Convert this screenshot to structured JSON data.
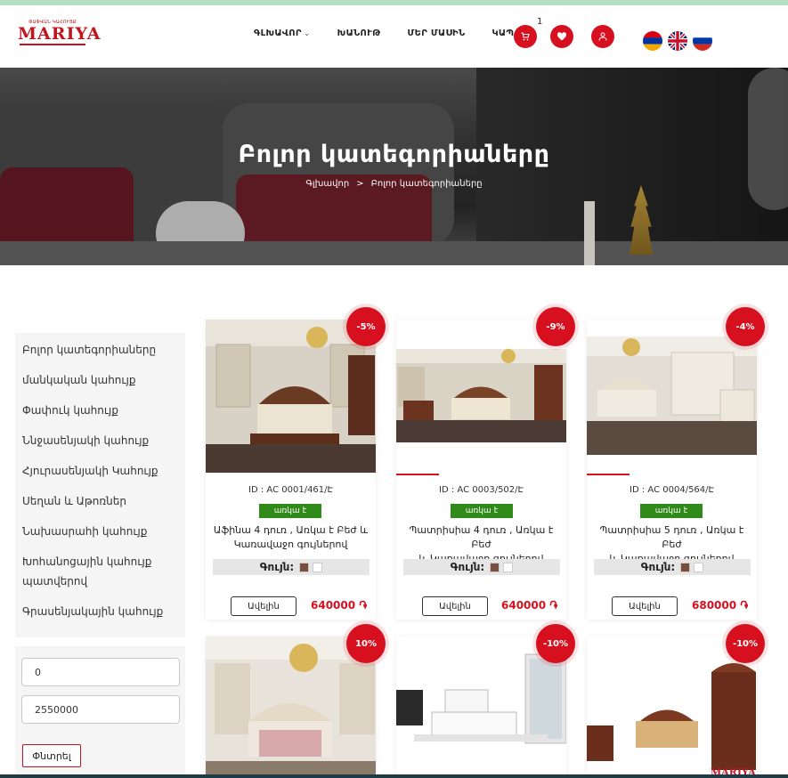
{
  "header": {
    "logo_top": "ՓԱՓՎԱՆ ԿԱՀՈՒՅՔ",
    "logo_main": "MARIYA",
    "nav": [
      "ԳԼԽԱՎՈՐ",
      "ԽԱՆՈՒԹ",
      "ՄԵՐ ՄԱՍԻՆ",
      "ԿԱՊ"
    ],
    "cart_count": "1",
    "languages": [
      "Armenian",
      "English",
      "Russian"
    ]
  },
  "hero": {
    "title": "Բոլոր կատեգորիաները",
    "breadcrumb_home": "Գլխավոր",
    "breadcrumb_sep": ">",
    "breadcrumb_current": "Բոլոր կատեգորիաները"
  },
  "sidebar": {
    "categories": [
      "Բոլոր կատեգորիաները",
      "մանկական կահույք",
      "Փափուկ կահույք",
      "Ննջասենյակի կահույք",
      "Հյուրասենյակի Կահույք",
      "Սեղան և Աթոռներ",
      "Նախասրահի կահույք",
      "Խոհանոցային կահույք",
      "պատվերով",
      "Գրասենյակային կահույք"
    ],
    "price_min": "0",
    "price_max": "2550000",
    "search_label": "Փնտրել"
  },
  "products": [
    {
      "badge": "-5%",
      "id": "ID : AC 0001/461/Է",
      "stock": "առկա է",
      "name1": "Աֆինա 4 դուռ , Առկա է Բեժ և",
      "name2": "Կառավաջո գույներով",
      "color_label": "Գույն:",
      "swatch1": "#7a4e3c",
      "swatch2": "#ffffff",
      "more": "Ավելին",
      "price": "640000 ֏"
    },
    {
      "badge": "-9%",
      "id": "ID : AC 0003/502/Է",
      "stock": "առկա է",
      "name1": "Պատրիսիա 4 դուռ , Առկա է Բեժ",
      "name2": "և Կառավաջո գույներով",
      "color_label": "Գույն:",
      "swatch1": "#7a4e3c",
      "swatch2": "#ffffff",
      "more": "Ավելին",
      "price": "640000 ֏"
    },
    {
      "badge": "-4%",
      "id": "ID : AC 0004/564/Է",
      "stock": "առկա է",
      "name1": "Պատրիսիա 5 դուռ , Առկա է Բեժ",
      "name2": "և Կառավաջո գույներով",
      "color_label": "Գույն:",
      "swatch1": "#7a4e3c",
      "swatch2": "#ffffff",
      "more": "Ավելին",
      "price": "680000 ֏"
    },
    {
      "badge": "10%"
    },
    {
      "badge": "-10%"
    },
    {
      "badge": "-10%",
      "watermark": "MARIYA"
    }
  ],
  "colors": {
    "accent": "#d7101f",
    "stock_green": "#2f8a1a"
  }
}
